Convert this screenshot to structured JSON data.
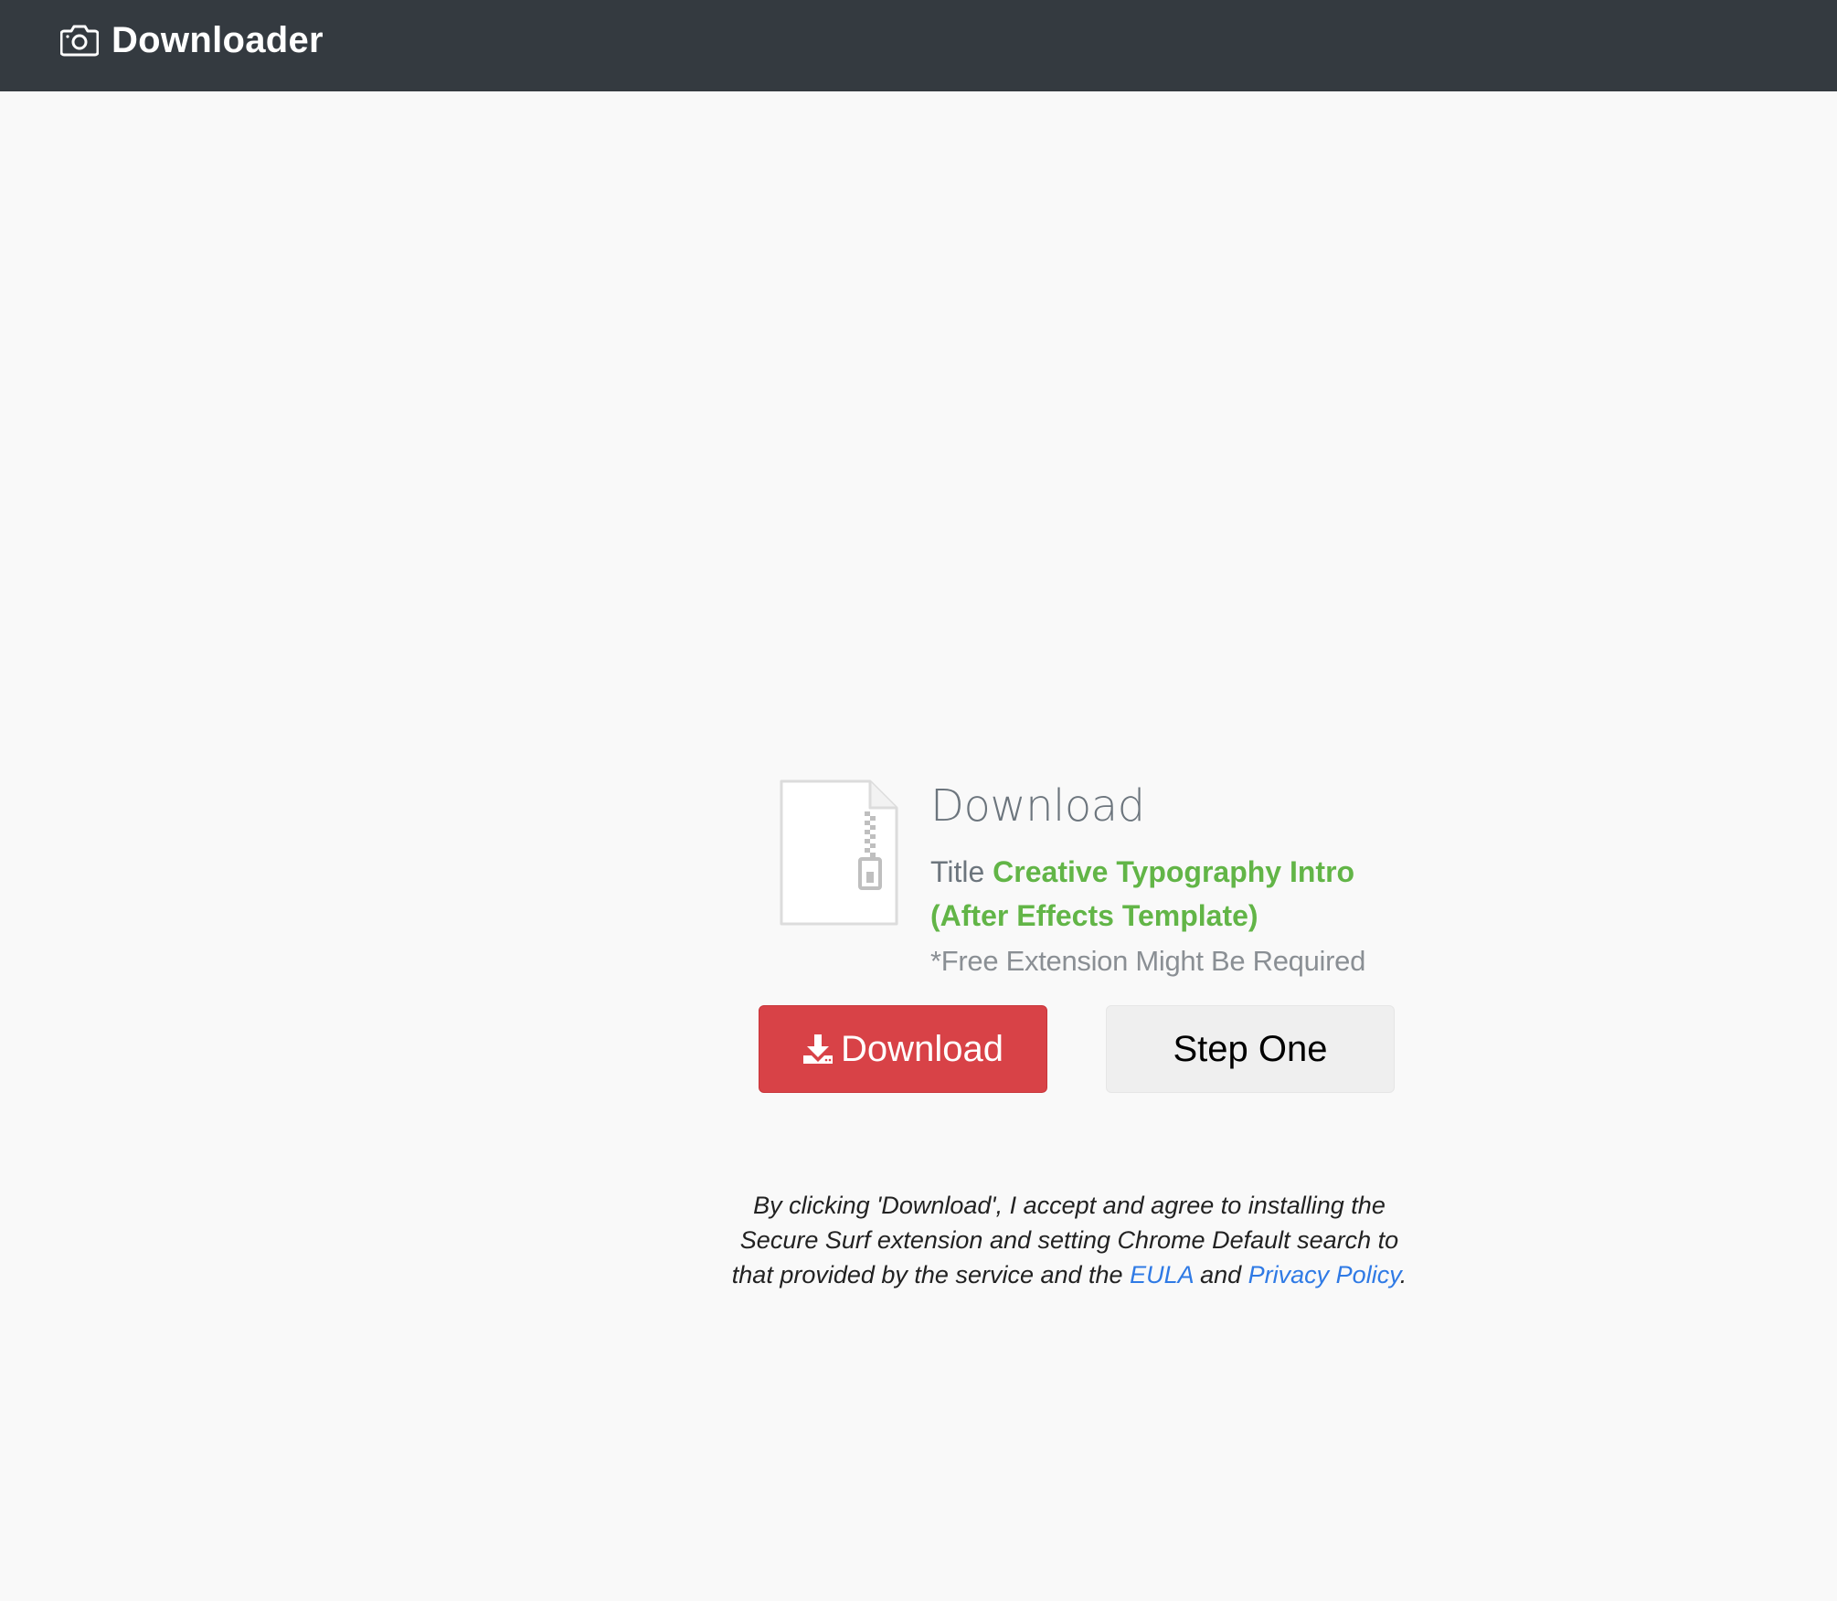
{
  "navbar": {
    "brand_icon": "camera-icon",
    "brand_text": "Downloader",
    "background": "#343a40"
  },
  "card": {
    "file_icon": "zip-file-icon",
    "heading": "Download",
    "title_label": "Title",
    "title_value": "Creative Typography Intro (After Effects Template)",
    "note": "*Free Extension Might Be Required"
  },
  "buttons": {
    "download_icon": "download-icon",
    "download_label": "Download",
    "step_label": "Step One"
  },
  "disclaimer": {
    "text_before": "By clicking 'Download', I accept and agree to installing the Secure Surf extension and setting Chrome Default search to that provided by the service and the ",
    "eula_link": "EULA",
    "and_text": " and ",
    "privacy_link": "Privacy Policy",
    "period": "."
  },
  "colors": {
    "accent_green": "#62b547",
    "download_red": "#d84247",
    "link_blue": "#2f7ae5"
  }
}
